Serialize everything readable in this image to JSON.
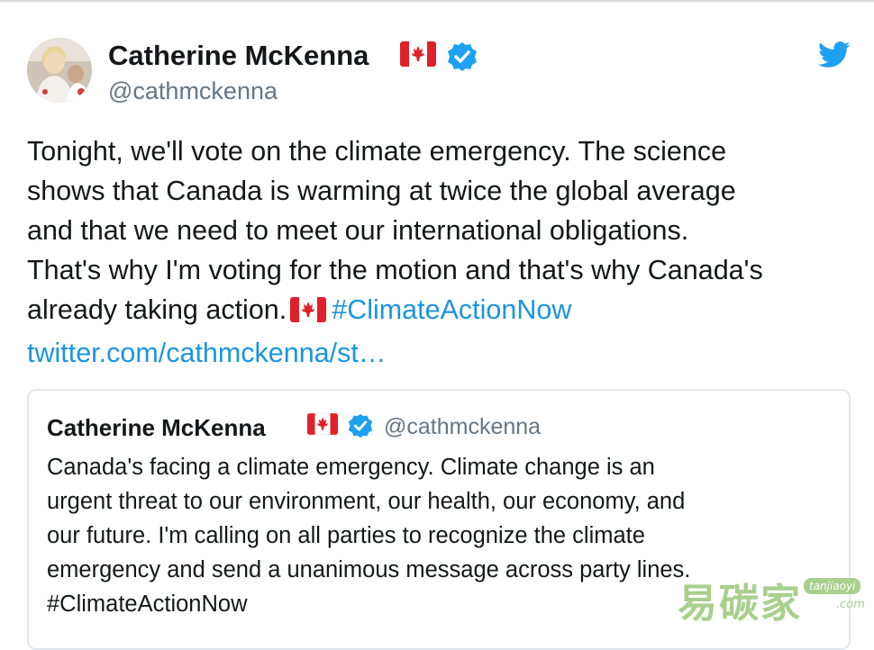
{
  "tweet": {
    "author_name": "Catherine McKenna",
    "author_handle": "@cathmckenna",
    "text_lines": [
      "Tonight, we'll vote on the climate emergency. The science",
      "shows that Canada is warming at twice the global average",
      "and that we need to meet our international obligations.",
      "That's why I'm voting for the motion and that's why Canada's"
    ],
    "text_line5_prefix": "already taking action.",
    "hashtag": "#ClimateActionNow",
    "link_text": "twitter.com/cathmckenna/st…",
    "icons": {
      "flag": "canada-flag-icon",
      "verified": "verified-badge-icon",
      "platform": "twitter-bird-icon"
    }
  },
  "quoted_tweet": {
    "author_name": "Catherine McKenna",
    "author_handle": "@cathmckenna",
    "text_lines": [
      "Canada's facing a climate emergency. Climate change is an",
      "urgent threat to our environment, our health, our economy, and",
      "our future. I'm calling on all parties to recognize the climate",
      "emergency and send a unanimous message across party lines.",
      "#ClimateActionNow"
    ]
  },
  "watermark": {
    "cn": "易碳家",
    "en": "tanjiaoyi",
    "com": ".com"
  },
  "colors": {
    "link": "#1b95e0",
    "verified": "#1da1f2",
    "handle": "#657786",
    "flag_red": "#e0202b",
    "watermark": "#a8d08d"
  }
}
